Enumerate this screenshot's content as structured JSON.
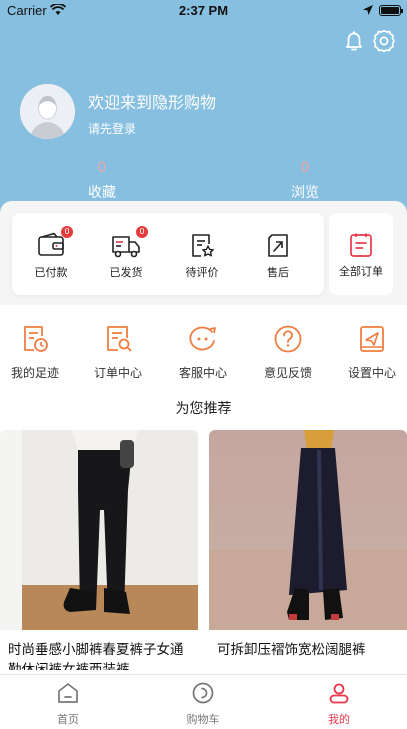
{
  "status_bar": {
    "carrier": "Carrier",
    "time": "2:37 PM"
  },
  "profile": {
    "welcome": "欢迎来到隐形购物",
    "login_prompt": "请先登录"
  },
  "stats": [
    {
      "count": "0",
      "label": "收藏"
    },
    {
      "count": "0",
      "label": "浏览"
    }
  ],
  "orders": {
    "items": [
      {
        "label": "已付款",
        "badge": "0",
        "icon": "wallet-icon"
      },
      {
        "label": "已发货",
        "badge": "0",
        "icon": "truck-icon"
      },
      {
        "label": "待评价",
        "icon": "review-icon"
      },
      {
        "label": "售后",
        "icon": "after-sales-icon"
      }
    ],
    "all_label": "全部订单"
  },
  "services": [
    {
      "label": "我的足迹",
      "icon": "footprint-icon"
    },
    {
      "label": "订单中心",
      "icon": "order-search-icon"
    },
    {
      "label": "客服中心",
      "icon": "chat-icon"
    },
    {
      "label": "意见反馈",
      "icon": "question-icon"
    },
    {
      "label": "设置中心",
      "icon": "send-icon"
    }
  ],
  "recommend_title": "为您推荐",
  "products": [
    {
      "name": "时尚垂感小脚裤春夏裤子女通勤休闲裤女裤西装裤"
    },
    {
      "name": "可拆卸压褶饰宽松阔腿裤"
    }
  ],
  "tabs": [
    {
      "label": "首页",
      "icon": "home-icon"
    },
    {
      "label": "购物车",
      "icon": "cart-icon"
    },
    {
      "label": "我的",
      "icon": "user-icon"
    }
  ],
  "colors": {
    "header": "#86bfe0",
    "accent": "#e8384a",
    "service_icon": "#f07d3f",
    "badge": "#e53b3b"
  }
}
